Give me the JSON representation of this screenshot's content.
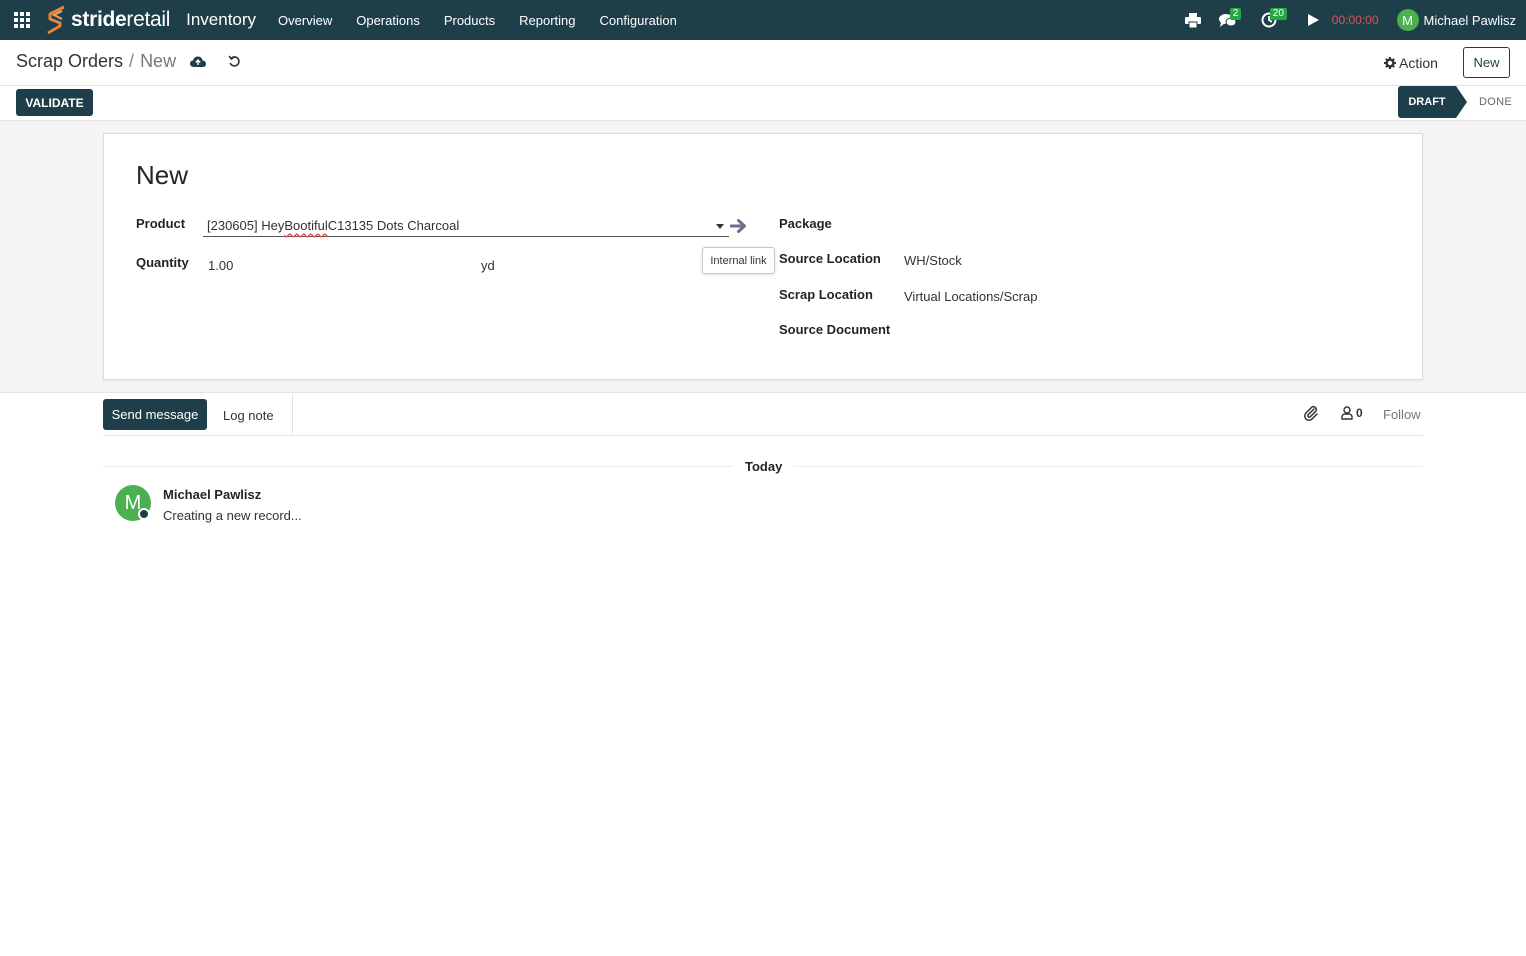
{
  "navbar": {
    "logo_brand_bold": "stride",
    "logo_brand_light": "retail",
    "app_name": "Inventory",
    "menu": [
      "Overview",
      "Operations",
      "Products",
      "Reporting",
      "Configuration"
    ],
    "messages_badge": "2",
    "activities_badge": "20",
    "timer": "00:00:00",
    "user_initial": "M",
    "user_name": "Michael Pawlisz"
  },
  "control": {
    "breadcrumb_parent": "Scrap Orders",
    "breadcrumb_sep": "/",
    "breadcrumb_current": "New",
    "action_label": "Action",
    "new_label": "New"
  },
  "statusbar": {
    "validate_label": "VALIDATE",
    "stages": [
      "DRAFT",
      "DONE"
    ],
    "active_stage": "DRAFT"
  },
  "form": {
    "title": "New",
    "product_label": "Product",
    "product_code": "[230605] Hey ",
    "product_misspelled": "Bootiful",
    "product_rest": " C13135 Dots Charcoal",
    "quantity_label": "Quantity",
    "quantity_value": "1.00",
    "uom": "yd",
    "tooltip": "Internal link",
    "package_label": "Package",
    "source_location_label": "Source Location",
    "source_location_value": "WH/Stock",
    "scrap_location_label": "Scrap Location",
    "scrap_location_value": "Virtual Locations/Scrap",
    "source_document_label": "Source Document"
  },
  "chatter": {
    "send_label": "Send message",
    "log_label": "Log note",
    "followers_count": "0",
    "follow_label": "Follow",
    "date_separator": "Today",
    "messages": [
      {
        "initial": "M",
        "author": "Michael Pawlisz",
        "body": "Creating a new record..."
      }
    ]
  },
  "colors": {
    "primary": "#1e3f4a",
    "badge": "#28a745",
    "avatar": "#4caf50",
    "timer": "#e05050"
  }
}
